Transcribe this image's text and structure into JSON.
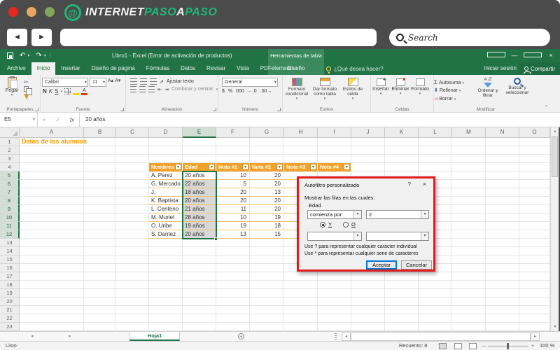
{
  "browser": {
    "logo_text_1": "INTERNET",
    "logo_text_2": "PASO",
    "logo_text_3": "A",
    "logo_text_4": "PASO",
    "logo_glyph": "@",
    "search_label": "Search"
  },
  "excel": {
    "titlebar": {
      "title": "Libro1 - Excel (Error de activación de productos)",
      "context": "Herramientas de tabla"
    },
    "tabs": {
      "items": [
        "Archivo",
        "Inicio",
        "Insertar",
        "Diseño de página",
        "Fórmulas",
        "Datos",
        "Revisar",
        "Vista",
        "PDFelement"
      ],
      "active": "Inicio",
      "contextual": "Diseño",
      "tell_me": "¿Qué desea hacer?",
      "sign_in": "Iniciar sesión",
      "share": "Compartir"
    },
    "ribbon": {
      "clipboard": {
        "paste": "Pegar",
        "label": "Portapapeles"
      },
      "font": {
        "name": "Calibri",
        "size": "11",
        "bold": "N",
        "italic": "K",
        "underline": "S",
        "label": "Fuente"
      },
      "alignment": {
        "wrap": "Ajustar texto",
        "merge": "Combinar y centrar",
        "label": "Alineación"
      },
      "number": {
        "format": "General",
        "label": "Número"
      },
      "styles": {
        "conditional": "Formato condicional",
        "format_table": "Dar formato como tabla",
        "cell_styles": "Estilos de celda",
        "label": "Estilos"
      },
      "cells": {
        "insert": "Insertar",
        "delete": "Eliminar",
        "format": "Formato",
        "label": "Celdas"
      },
      "editing": {
        "autosum": "Autosuma",
        "fill": "Rellenar",
        "clear": "Borrar",
        "sort": "Ordenar y filtrar",
        "find": "Buscar y seleccionar",
        "label": "Modificar"
      }
    },
    "formula_bar": {
      "name_box": "E5",
      "fx": "fx",
      "value": "20 años"
    },
    "sheet": {
      "columns": [
        "A",
        "B",
        "C",
        "D",
        "E",
        "F",
        "G",
        "H",
        "I",
        "J",
        "K",
        "L",
        "M",
        "N",
        "O"
      ],
      "row_count": 23,
      "title_cell": {
        "ref": "A1",
        "text": "Datos de los alumnos"
      },
      "table": {
        "header_row": 4,
        "start_col": "D",
        "headers": [
          "Nombres",
          "Edad",
          "Nota #1",
          "Nota #2",
          "Nota #3",
          "Nota #4"
        ],
        "rows": [
          [
            "A. Perez",
            "20 años",
            "10",
            "20",
            "",
            ""
          ],
          [
            "G. Mercado",
            "22 años",
            "5",
            "20",
            "",
            ""
          ],
          [
            "J. Hernandez",
            "18 años",
            "20",
            "13",
            "",
            ""
          ],
          [
            "K. Baptista",
            "20 años",
            "20",
            "20",
            "",
            ""
          ],
          [
            "L. Centeno",
            "21 años",
            "11",
            "20",
            "",
            ""
          ],
          [
            "M. Muriel",
            "28 años",
            "10",
            "19",
            "",
            ""
          ],
          [
            "O. Uribe",
            "19 años",
            "19",
            "18",
            "",
            ""
          ],
          [
            "S. Dantez",
            "20 años",
            "13",
            "15",
            "",
            ""
          ]
        ]
      },
      "selection": {
        "range": "E5:E12",
        "col": "E",
        "active_cell": "E5"
      }
    },
    "sheet_bar": {
      "tab": "Hoja1"
    },
    "status_bar": {
      "mode": "Listo",
      "count": "Recuento: 8",
      "zoom": "100 %"
    }
  },
  "dialog": {
    "title": "Autofiltro personalizado",
    "help": "?",
    "close": "×",
    "prompt": "Mostrar las filas en las cuales:",
    "field": "Edad",
    "operator": "comienza por",
    "value": "2",
    "and_label": "Y",
    "or_label": "O",
    "hint1": "Use ? para representar cualquier carácter individual",
    "hint2": "Use * para representar cualquier serie de caracteres",
    "ok": "Aceptar",
    "cancel": "Cancelar"
  },
  "icons": {
    "dropdown": "▾",
    "sigma": "Σ",
    "undo": "↶",
    "redo": "↷",
    "check": "✓",
    "x": "×",
    "cut": "✂",
    "up": "▴",
    "down": "▾",
    "left": "◂",
    "right": "▸",
    "back": "◄",
    "forward": "►",
    "minus": "—",
    "plus": "+",
    "more": "⋮",
    "dec_left": "←.0",
    "dec_right": ".00→",
    "percent": "%",
    "currency": "$",
    "thousands": "000",
    "collapse": "⌃",
    "a_big": "A",
    "a_small": "A",
    "az": "A↓Z"
  },
  "colors": {
    "excel_green": "#217346",
    "contextual_green": "#3a8a5e",
    "table_header_orange": "#efa32b",
    "title_orange": "#f59b00",
    "annotation_red": "#e21c1c",
    "logo_green": "#1db87e",
    "accent_blue": "#0078d7"
  }
}
